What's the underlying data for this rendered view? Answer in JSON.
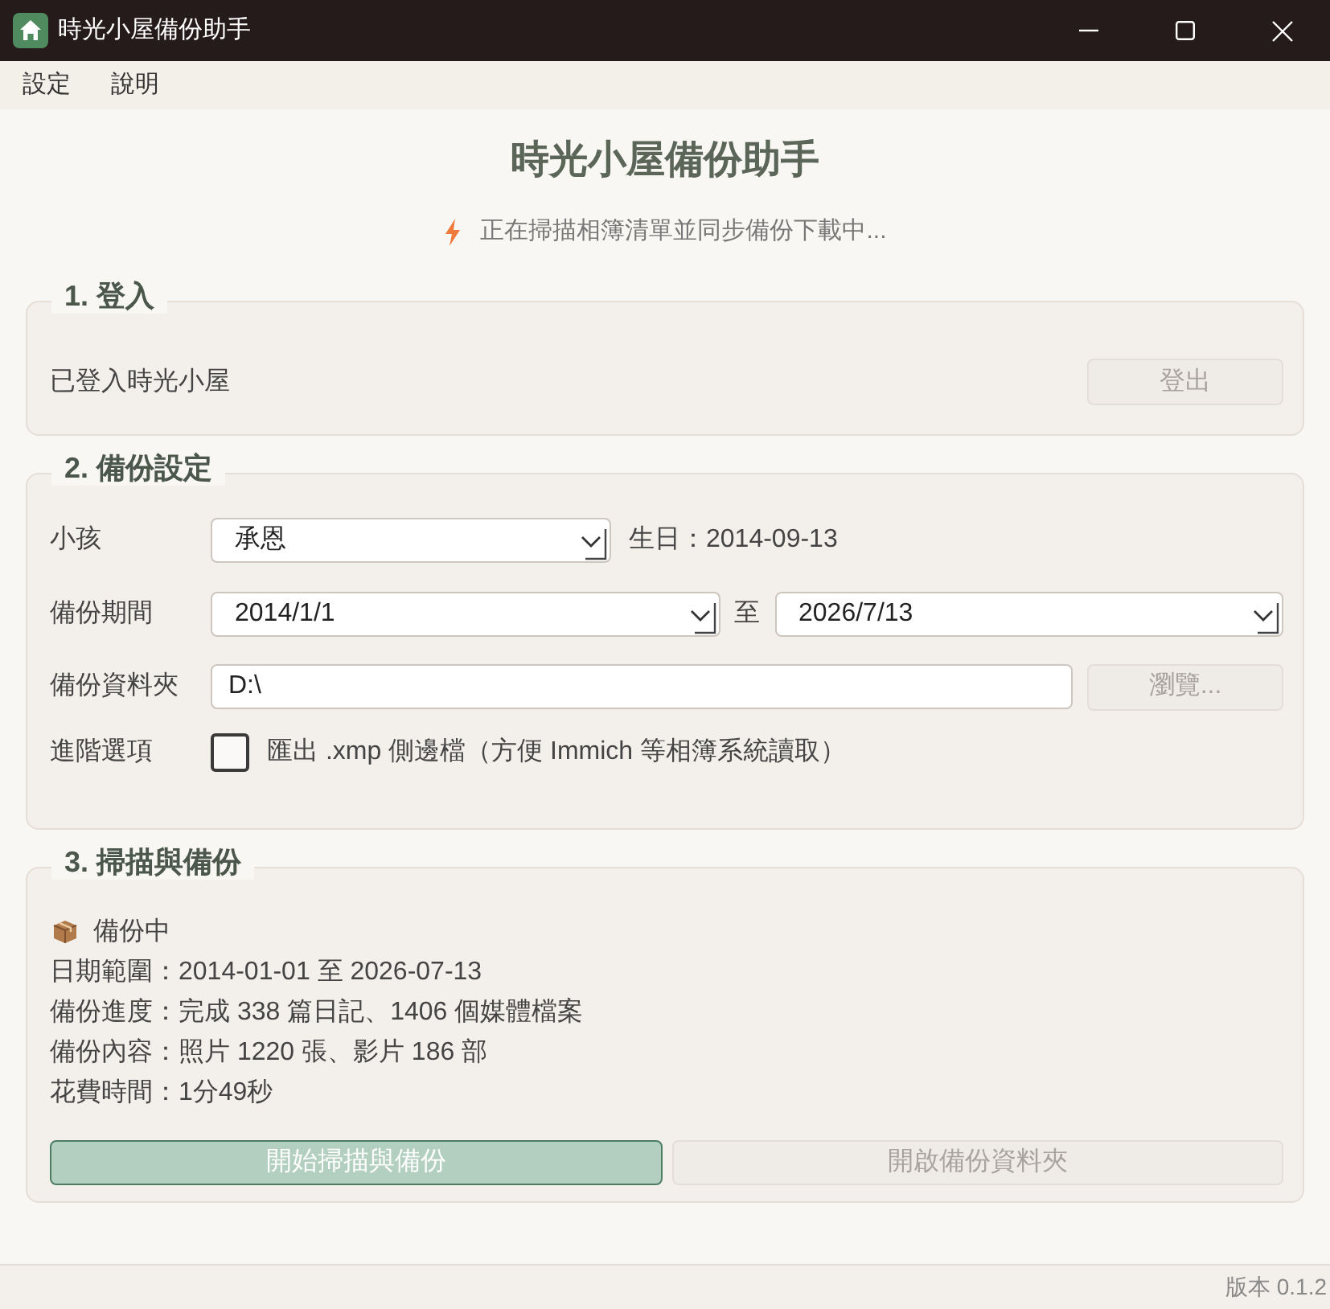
{
  "window": {
    "title": "時光小屋備份助手"
  },
  "menu": [
    {
      "label": "設定"
    },
    {
      "label": "說明"
    }
  ],
  "header": {
    "title": "時光小屋備份助手",
    "status": "正在掃描相簿清單並同步備份下載中..."
  },
  "login": {
    "legend": "1. 登入",
    "status": "已登入時光小屋",
    "logout_button": {
      "label": "登出",
      "disabled": true
    }
  },
  "settings": {
    "legend": "2. 備份設定",
    "child": {
      "label": "小孩",
      "value": "承恩",
      "birthday": "生日：2014-09-13"
    },
    "period": {
      "label": "備份期間",
      "from": "2014/1/1",
      "separator": "至",
      "to": "2026/7/13"
    },
    "folder": {
      "label": "備份資料夾",
      "value": "D:\\",
      "browse_button": {
        "label": "瀏覽...",
        "disabled": true
      }
    },
    "advanced": {
      "label": "進階選項",
      "option": "匯出 .xmp 側邊檔（方便 Immich 等相簿系統讀取）",
      "checked": false
    }
  },
  "scan": {
    "legend": "3. 掃描與備份",
    "status": "備份中",
    "details": [
      "日期範圍：2014-01-01 至 2026-07-13",
      "備份進度：完成 338 篇日記、1406 個媒體檔案",
      "備份內容：照片 1220 張、影片 186 部",
      "花費時間：1分49秒"
    ],
    "buttons": [
      {
        "label": "開始掃描與備份",
        "kind": "primary",
        "disabled": true
      },
      {
        "label": "開啟備份資料夾",
        "kind": "secondary",
        "disabled": true
      }
    ]
  },
  "status_bar": {
    "version": "版本 0.1.2"
  }
}
